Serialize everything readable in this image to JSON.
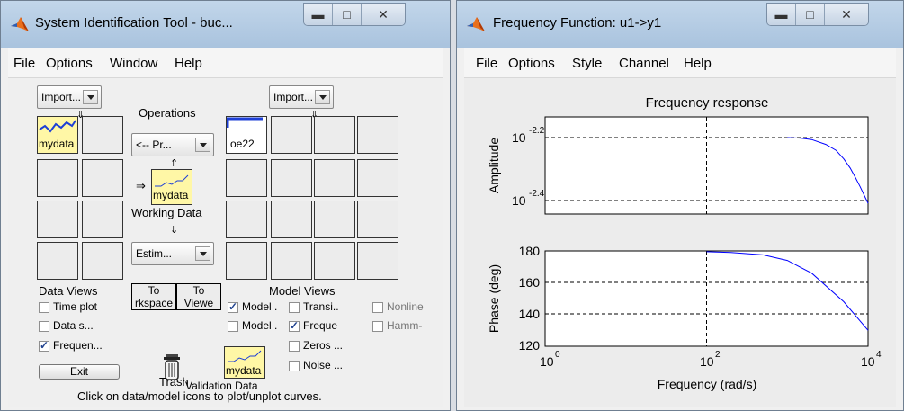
{
  "ident": {
    "title": "System Identification Tool - buc...",
    "menu": [
      "File",
      "Options",
      "Window",
      "Help"
    ],
    "import_data_popup": "Import...",
    "import_models_popup": "Import...",
    "operations_label": "Operations",
    "preprocess_popup": "<-- Pr...",
    "data_board": [
      {
        "label": "mydata",
        "selected": true
      }
    ],
    "working_data": {
      "name": "mydata",
      "label": "Working Data"
    },
    "estimate_popup": "Estim...",
    "model_board": [
      {
        "label": "oe22",
        "selected": false
      }
    ],
    "data_views": {
      "heading": "Data Views",
      "items": [
        {
          "label": "Time plot",
          "checked": false
        },
        {
          "label": "Data s...",
          "checked": false
        },
        {
          "label": "Frequen...",
          "checked": true
        }
      ]
    },
    "to_workspace_label": "To\nrkspace",
    "to_viewer_label": "To\nViewe",
    "model_views": {
      "heading": "Model Views",
      "col1": [
        {
          "label": "Model .",
          "checked": true
        },
        {
          "label": "Model .",
          "checked": false
        }
      ],
      "col2": [
        {
          "label": "Transi..",
          "checked": false
        },
        {
          "label": "Freque",
          "checked": true
        },
        {
          "label": "Zeros ...",
          "checked": false
        },
        {
          "label": "Noise ...",
          "checked": false
        }
      ],
      "col3": [
        {
          "label": "Nonline",
          "checked": false
        },
        {
          "label": "Hamm-",
          "checked": false
        }
      ]
    },
    "exit_label": "Exit",
    "trash_label": "Trash",
    "validation": {
      "name": "mydata",
      "label": "Validation Data"
    },
    "status": "Click on data/model icons to plot/unplot curves."
  },
  "freq": {
    "title": "Frequency Function: u1->y1",
    "menu": [
      "File",
      "Options",
      "Style",
      "Channel",
      "Help"
    ],
    "plot_title": "Frequency response",
    "amp_ylabel": "Amplitude",
    "phase_ylabel": "Phase (deg)",
    "xlabel": "Frequency (rad/s)",
    "amp_ticks": [
      "10",
      "-2.2",
      "10",
      "-2.4"
    ],
    "phase_ticks": [
      "180",
      "160",
      "140",
      "120"
    ],
    "x_ticks": [
      "10",
      "0",
      "10",
      "2",
      "10",
      "4"
    ],
    "line_color": "#0000ff"
  },
  "chart_data": [
    {
      "type": "line",
      "title": "Frequency response",
      "ylabel": "Amplitude",
      "xscale": "log",
      "yscale": "log",
      "xlim": [
        1,
        10000
      ],
      "ylim": [
        0.00363,
        0.00661
      ],
      "grid": true,
      "series": [
        {
          "x": [
            1000,
            1500,
            2000,
            3000,
            4000,
            5000,
            6000,
            7000,
            8000,
            10000
          ],
          "values": [
            0.00631,
            0.00628,
            0.00622,
            0.006,
            0.00575,
            0.0054,
            0.00505,
            0.0047,
            0.0044,
            0.0039
          ]
        }
      ]
    },
    {
      "type": "line",
      "ylabel": "Phase (deg)",
      "xlabel": "Frequency (rad/s)",
      "xscale": "log",
      "xlim": [
        1,
        10000
      ],
      "ylim": [
        120,
        180
      ],
      "grid": true,
      "series": [
        {
          "x": [
            100,
            200,
            500,
            1000,
            2000,
            5000,
            10000
          ],
          "values": [
            179.5,
            179,
            177.5,
            174,
            166,
            148,
            130
          ]
        }
      ]
    }
  ]
}
